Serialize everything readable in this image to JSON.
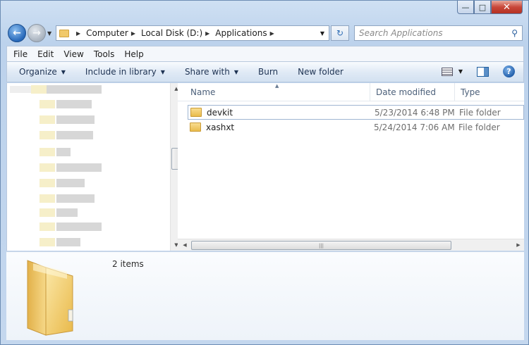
{
  "window": {
    "caption": {
      "minimize": "—",
      "maximize": "□",
      "close": "✕"
    }
  },
  "nav": {
    "back_glyph": "←",
    "forward_glyph": "→",
    "dropdown_glyph": "▼",
    "refresh_glyph": "↻"
  },
  "address": {
    "crumbs": [
      "Computer",
      "Local Disk (D:)",
      "Applications"
    ],
    "separator_glyph": "▶"
  },
  "search": {
    "placeholder": "Search Applications",
    "icon": "search-icon"
  },
  "menu": [
    "File",
    "Edit",
    "View",
    "Tools",
    "Help"
  ],
  "commands": [
    {
      "label": "Organize",
      "dropdown": true
    },
    {
      "label": "Include in library",
      "dropdown": true
    },
    {
      "label": "Share with",
      "dropdown": true
    },
    {
      "label": "Burn",
      "dropdown": false
    },
    {
      "label": "New folder",
      "dropdown": false
    }
  ],
  "columns": {
    "name": "Name",
    "date": "Date modified",
    "type": "Type"
  },
  "files": [
    {
      "name": "devkit",
      "date": "5/23/2014 6:48 PM",
      "type": "File folder",
      "selected": true
    },
    {
      "name": "xashxt",
      "date": "5/24/2014 7:06 AM",
      "type": "File folder",
      "selected": false
    }
  ],
  "details": {
    "count": "2 items"
  },
  "colors": {
    "accent": "#2768b9",
    "folder": "#f1c96a"
  }
}
